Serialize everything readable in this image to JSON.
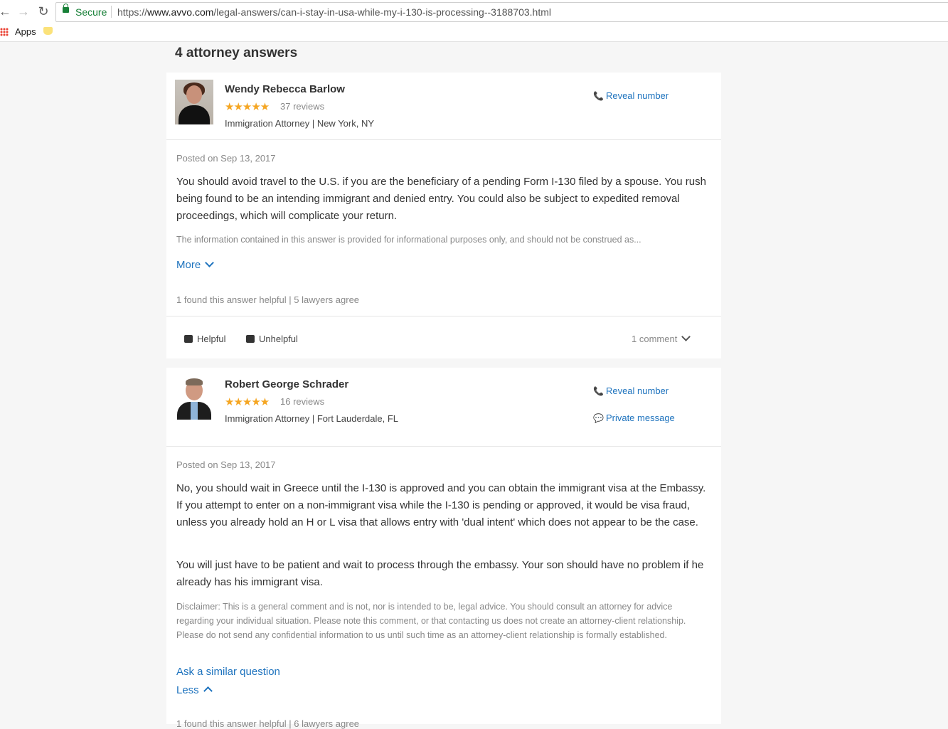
{
  "browser": {
    "secure_label": "Secure",
    "url_prefix": "https://",
    "url_host": "www.avvo.com",
    "url_path": "/legal-answers/can-i-stay-in-usa-while-my-i-130-is-processing--3188703.html",
    "bookmark_apps": "Apps"
  },
  "page": {
    "answers_title": "4 attorney answers"
  },
  "answers": [
    {
      "name": "Wendy Rebecca Barlow",
      "stars": "★★★★★",
      "reviews": "37 reviews",
      "meta": "Immigration Attorney | New York, NY",
      "reveal": "Reveal number",
      "posted": "Posted on Sep 13, 2017",
      "body": "You should avoid travel to the U.S. if you are the beneficiary of a pending Form I-130 filed by a spouse. You rush being found to be an intending immigrant and denied entry. You could also be subject to expedited removal proceedings, which will complicate your return.",
      "disclaimer": "The information contained in this answer is provided for informational purposes only, and should not be construed as...",
      "more": "More",
      "helpful_line": "1 found this answer helpful | 5 lawyers agree",
      "helpful": "Helpful",
      "unhelpful": "Unhelpful",
      "comments": "1 comment"
    },
    {
      "name": "Robert George Schrader",
      "stars": "★★★★★",
      "reviews": "16 reviews",
      "meta": "Immigration Attorney | Fort Lauderdale, FL",
      "reveal": "Reveal number",
      "private": "Private message",
      "posted": "Posted on Sep 13, 2017",
      "body1": "No, you should wait in Greece until the I-130 is approved and you can obtain the immigrant visa at the Embassy. If you attempt to enter on a non-immigrant visa while the I-130 is pending or approved, it would be visa fraud, unless you already hold an H or L visa that allows entry with 'dual intent' which does not appear to be the case.",
      "body2": "You will just have to be patient and wait to process through the embassy. Your son should have no problem if he already has his immigrant visa.",
      "disclaimer": "Disclaimer: This is a general comment and is not, nor is intended to be, legal advice. You should consult an attorney for advice regarding your individual situation. Please note this comment, or that contacting us does not create an attorney-client relationship. Please do not send any confidential information to us until such time as an attorney-client relationship is formally established.",
      "ask": "Ask a similar question",
      "less": "Less",
      "helpful_line_partial": "1 found this answer helpful | 6 lawyers agree"
    }
  ]
}
